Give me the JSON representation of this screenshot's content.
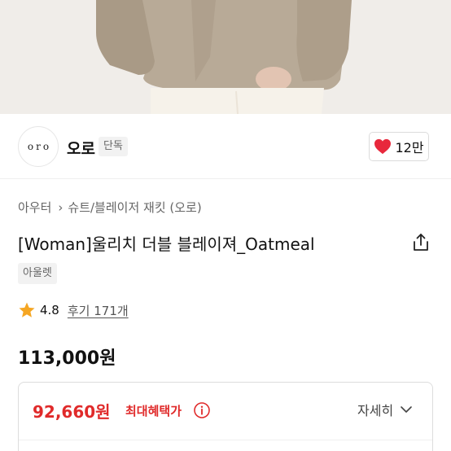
{
  "brand": {
    "logo_text": "oro",
    "name": "오로",
    "badge": "단독",
    "like_count": "12만"
  },
  "breadcrumb": {
    "level1": "아우터",
    "level2": "슈트/블레이저 재킷 (오로)"
  },
  "product": {
    "title": "[Woman]울리치 더블 블레이져_Oatmeal",
    "tag": "아울렛",
    "rating": "4.8",
    "review_link": "후기 171개",
    "price": "113,000원"
  },
  "benefit": {
    "price": "92,660원",
    "label": "최대혜택가",
    "detail_button": "자세히"
  },
  "colors": {
    "accent_red": "#e02a2a",
    "heart": "#e8283c",
    "star": "#f5a623"
  },
  "icons": [
    "heart-icon",
    "share-icon",
    "star-icon",
    "info-icon",
    "chevron-down-icon"
  ]
}
